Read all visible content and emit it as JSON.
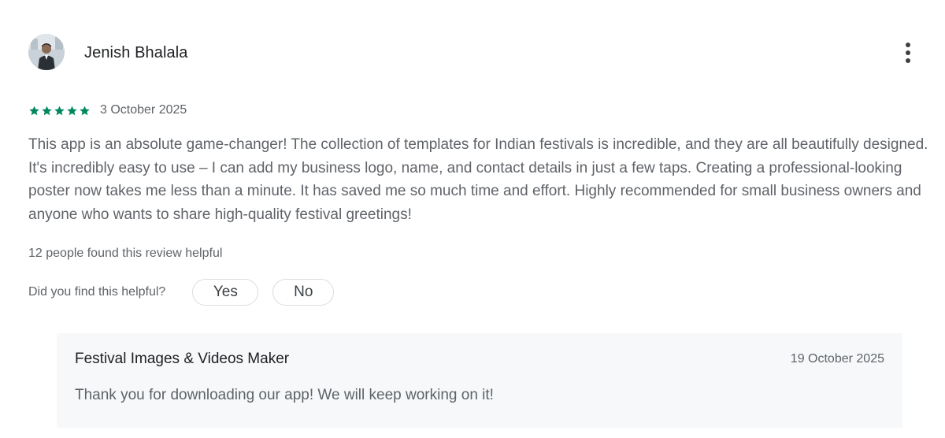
{
  "review": {
    "reviewer_name": "Jenish Bhalala",
    "rating": 5,
    "max_rating": 5,
    "star_color": "#01875f",
    "date": "3 October 2025",
    "text": "This app is an absolute game-changer! The collection of templates for Indian festivals is incredible, and they are all beautifully designed. It's incredibly easy to use – I can add my business logo, name, and contact details in just a few taps. Creating a professional-looking poster now takes me less than a minute. It has saved me so much time and effort. Highly recommended for small business owners and anyone who wants to share high-quality festival greetings!",
    "helpful_count_text": "12 people found this review helpful",
    "helpful_question": "Did you find this helpful?",
    "yes_label": "Yes",
    "no_label": "No",
    "more_icon": "more-vertical-icon"
  },
  "developer_reply": {
    "name": "Festival Images & Videos Maker",
    "date": "19 October 2025",
    "text": "Thank you for downloading our app! We will keep working on it!",
    "background_color": "#f6f8fa"
  }
}
